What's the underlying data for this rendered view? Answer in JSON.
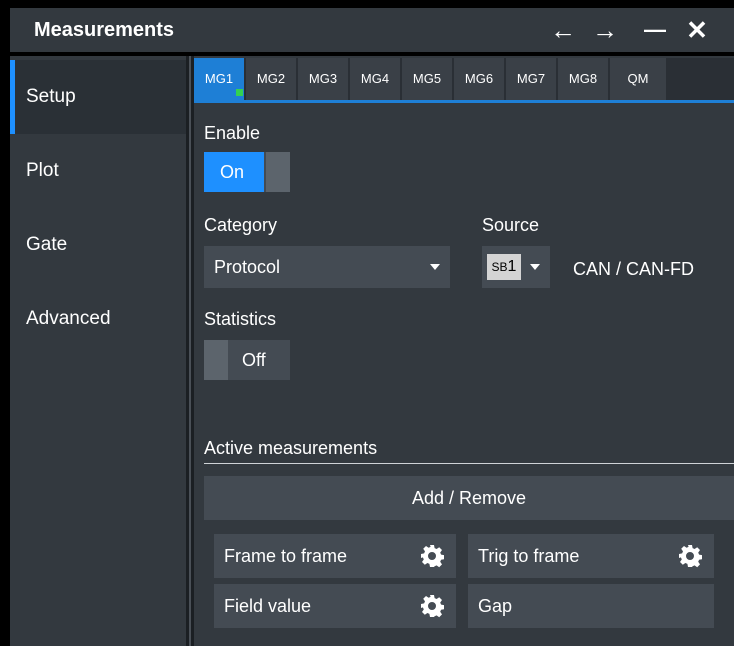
{
  "window": {
    "title": "Measurements",
    "controls": {
      "back": "←",
      "forward": "→",
      "minimize": "—",
      "close": "✕"
    }
  },
  "sidebar": {
    "items": [
      {
        "label": "Setup",
        "active": true
      },
      {
        "label": "Plot",
        "active": false
      },
      {
        "label": "Gate",
        "active": false
      },
      {
        "label": "Advanced",
        "active": false
      }
    ]
  },
  "tabs": [
    {
      "label": "MG1",
      "active": true
    },
    {
      "label": "MG2",
      "active": false
    },
    {
      "label": "MG3",
      "active": false
    },
    {
      "label": "MG4",
      "active": false
    },
    {
      "label": "MG5",
      "active": false
    },
    {
      "label": "MG6",
      "active": false
    },
    {
      "label": "MG7",
      "active": false
    },
    {
      "label": "MG8",
      "active": false
    },
    {
      "label": "QM",
      "active": false
    }
  ],
  "enable": {
    "label": "Enable",
    "value": "On"
  },
  "category": {
    "label": "Category",
    "value": "Protocol"
  },
  "source": {
    "label": "Source",
    "chip_prefix": "SB",
    "chip_num": "1",
    "protocol": "CAN / CAN-FD"
  },
  "statistics": {
    "label": "Statistics",
    "value": "Off"
  },
  "active_measurements": {
    "heading": "Active measurements",
    "add_remove_label": "Add / Remove",
    "items": [
      {
        "label": "Frame to frame",
        "has_settings": true
      },
      {
        "label": "Trig to frame",
        "has_settings": true
      },
      {
        "label": "Field value",
        "has_settings": true
      },
      {
        "label": "Gap",
        "has_settings": false
      }
    ]
  },
  "colors": {
    "accent": "#1e90ff",
    "panel": "#33393f",
    "control": "#444b53",
    "indicator": "#33d152"
  }
}
